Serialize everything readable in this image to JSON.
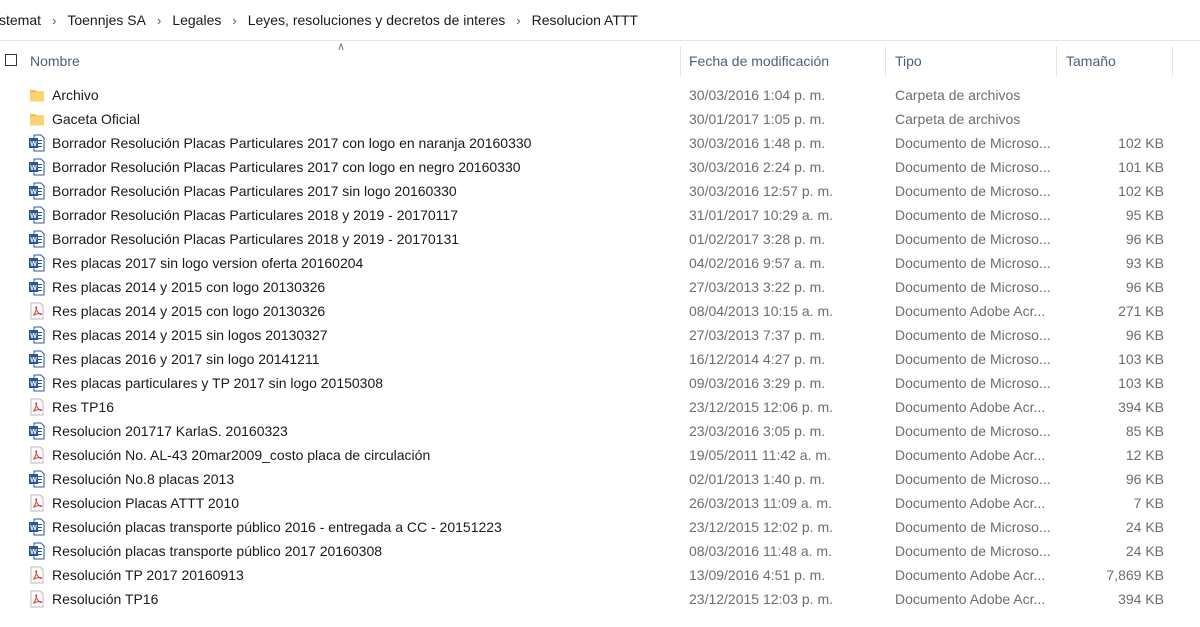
{
  "breadcrumb": [
    "stemat",
    "Toennjes SA",
    "Legales",
    "Leyes, resoluciones y decretos de interes",
    "Resolucion ATTT"
  ],
  "columns": {
    "name": "Nombre",
    "date": "Fecha de modificación",
    "type": "Tipo",
    "size": "Tamaño"
  },
  "icons": {
    "folder": "folder-icon",
    "word": "word-document-icon",
    "pdf": "pdf-document-icon"
  },
  "colors": {
    "folder": "#f5c342",
    "word": "#2b579a",
    "pdf": "#d4473b"
  },
  "files": [
    {
      "icon": "folder",
      "name": "Archivo",
      "date": "30/03/2016 1:04 p. m.",
      "type": "Carpeta de archivos",
      "size": ""
    },
    {
      "icon": "folder",
      "name": "Gaceta Oficial",
      "date": "30/01/2017 1:05 p. m.",
      "type": "Carpeta de archivos",
      "size": ""
    },
    {
      "icon": "word",
      "name": "Borrador Resolución Placas Particulares 2017 con logo en naranja 20160330",
      "date": "30/03/2016 1:48 p. m.",
      "type": "Documento de Microso...",
      "size": "102 KB"
    },
    {
      "icon": "word",
      "name": "Borrador Resolución Placas Particulares 2017 con logo en negro 20160330",
      "date": "30/03/2016 2:24 p. m.",
      "type": "Documento de Microso...",
      "size": "101 KB"
    },
    {
      "icon": "word",
      "name": "Borrador Resolución Placas Particulares 2017 sin logo  20160330",
      "date": "30/03/2016 12:57 p. m.",
      "type": "Documento de Microso...",
      "size": "102 KB"
    },
    {
      "icon": "word",
      "name": "Borrador Resolución Placas Particulares 2018 y 2019 - 20170117",
      "date": "31/01/2017 10:29 a. m.",
      "type": "Documento de Microso...",
      "size": "95 KB"
    },
    {
      "icon": "word",
      "name": "Borrador Resolución Placas Particulares 2018 y 2019 - 20170131",
      "date": "01/02/2017 3:28 p. m.",
      "type": "Documento de Microso...",
      "size": "96 KB"
    },
    {
      "icon": "word",
      "name": "Res placas  2017 sin logo version oferta 20160204",
      "date": "04/02/2016 9:57 a. m.",
      "type": "Documento de Microso...",
      "size": "93 KB"
    },
    {
      "icon": "word",
      "name": "Res placas 2014 y 2015 con logo 20130326",
      "date": "27/03/2013 3:22 p. m.",
      "type": "Documento de Microso...",
      "size": "96 KB"
    },
    {
      "icon": "pdf",
      "name": "Res placas 2014 y 2015 con logo 20130326",
      "date": "08/04/2013 10:15 a. m.",
      "type": "Documento Adobe Acr...",
      "size": "271 KB"
    },
    {
      "icon": "word",
      "name": "Res placas 2014 y 2015 sin logos 20130327",
      "date": "27/03/2013 7:37 p. m.",
      "type": "Documento de Microso...",
      "size": "96 KB"
    },
    {
      "icon": "word",
      "name": "Res placas 2016 y 2017 sin logo 20141211",
      "date": "16/12/2014 4:27 p. m.",
      "type": "Documento de Microso...",
      "size": "103 KB"
    },
    {
      "icon": "word",
      "name": "Res placas particulares y TP 2017 sin logo 20150308",
      "date": "09/03/2016 3:29 p. m.",
      "type": "Documento de Microso...",
      "size": "103 KB"
    },
    {
      "icon": "pdf",
      "name": "Res TP16",
      "date": "23/12/2015 12:06 p. m.",
      "type": "Documento Adobe Acr...",
      "size": "394 KB"
    },
    {
      "icon": "word",
      "name": "Resolucion 201717 KarlaS. 20160323",
      "date": "23/03/2016 3:05 p. m.",
      "type": "Documento de Microso...",
      "size": "85 KB"
    },
    {
      "icon": "pdf",
      "name": "Resolución No. AL-43 20mar2009_costo placa de circulación",
      "date": "19/05/2011 11:42 a. m.",
      "type": "Documento Adobe Acr...",
      "size": "12 KB"
    },
    {
      "icon": "word",
      "name": "Resolución No.8 placas 2013",
      "date": "02/01/2013 1:40 p. m.",
      "type": "Documento de Microso...",
      "size": "96 KB"
    },
    {
      "icon": "pdf",
      "name": "Resolucion Placas ATTT 2010",
      "date": "26/03/2013 11:09 a. m.",
      "type": "Documento Adobe Acr...",
      "size": "7 KB"
    },
    {
      "icon": "word",
      "name": "Resolución placas transporte público 2016 - entregada a CC - 20151223",
      "date": "23/12/2015 12:02 p. m.",
      "type": "Documento de Microso...",
      "size": "24 KB"
    },
    {
      "icon": "word",
      "name": "Resolución placas transporte público 2017 20160308",
      "date": "08/03/2016 11:48 a. m.",
      "type": "Documento de Microso...",
      "size": "24 KB"
    },
    {
      "icon": "pdf",
      "name": "Resolución TP 2017 20160913",
      "date": "13/09/2016 4:51 p. m.",
      "type": "Documento Adobe Acr...",
      "size": "7,869 KB"
    },
    {
      "icon": "pdf",
      "name": "Resolución TP16",
      "date": "23/12/2015 12:03 p. m.",
      "type": "Documento Adobe Acr...",
      "size": "394 KB"
    }
  ]
}
